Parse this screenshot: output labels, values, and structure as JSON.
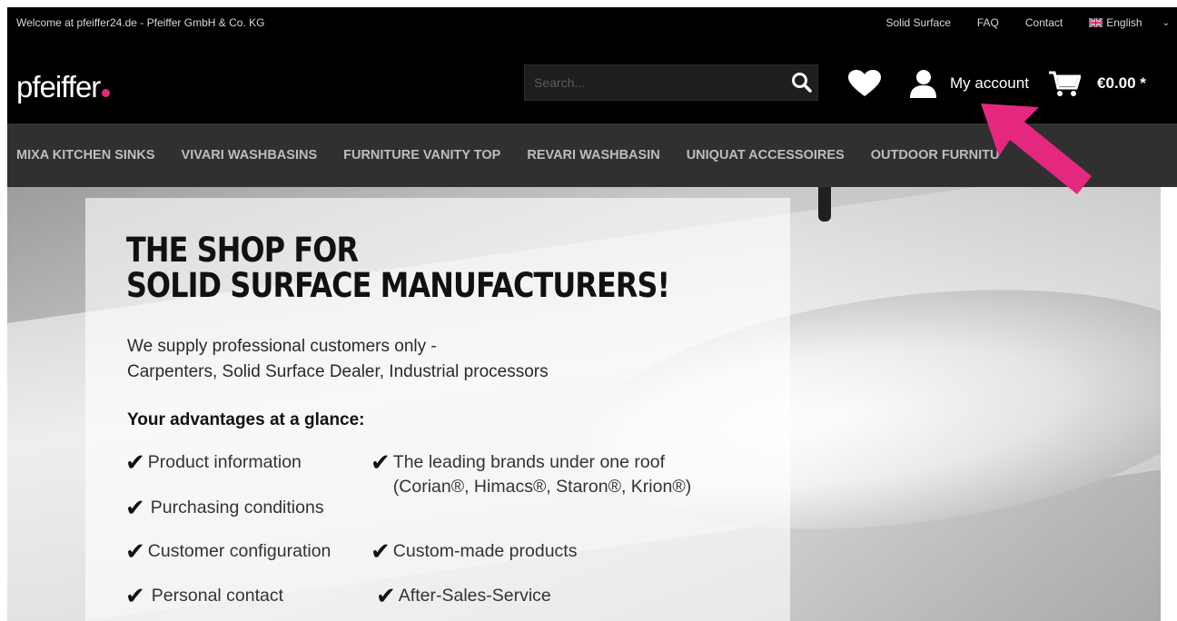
{
  "topbar": {
    "welcome": "Welcome at pfeiffer24.de - Pfeiffer GmbH & Co. KG",
    "links": [
      "Solid Surface",
      "FAQ",
      "Contact"
    ],
    "language": "English"
  },
  "header": {
    "logo": "pfeiffer",
    "search_placeholder": "Search...",
    "account_label": "My account",
    "cart_total": "€0.00 *"
  },
  "nav": {
    "items": [
      "MIXA KITCHEN SINKS",
      "VIVARI WASHBASINS",
      "FURNITURE VANITY TOP",
      "REVARI WASHBASIN",
      "UNIQUAT ACCESSOIRES",
      "OUTDOOR FURNITU"
    ]
  },
  "hero": {
    "headline_line1": "THE SHOP FOR",
    "headline_line2": "SOLID SURFACE MANUFACTURERS!",
    "sub_line1": "We supply professional customers only -",
    "sub_line2": "Carpenters, Solid Surface Dealer, Industrial processors",
    "advantages_title": "Your advantages at a glance:",
    "advantages": [
      "Product information",
      "Purchasing conditions",
      "Customer configuration",
      "Personal contact",
      "The leading brands under one roof",
      "(Corian®, Himacs®, Staron®, Krion®)",
      "Custom-made products",
      "After-Sales-Service"
    ]
  },
  "icons": {
    "search": "search-icon",
    "wishlist": "heart-icon",
    "account": "user-icon",
    "cart": "cart-icon",
    "language": "uk-flag-icon",
    "dropdown": "chevron-down-icon"
  },
  "colors": {
    "brand_pink": "#e4287f",
    "header_bg": "#000000",
    "nav_bg": "#303030"
  }
}
